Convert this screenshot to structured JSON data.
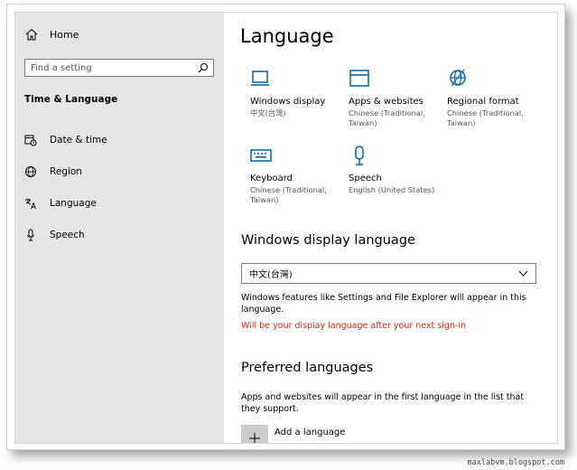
{
  "sidebar": {
    "home_label": "Home",
    "search_placeholder": "Find a setting",
    "section_title": "Time & Language",
    "items": [
      {
        "label": "Date & time",
        "icon": "calendar-clock-icon"
      },
      {
        "label": "Region",
        "icon": "globe-icon"
      },
      {
        "label": "Language",
        "icon": "language-icon"
      },
      {
        "label": "Speech",
        "icon": "microphone-icon"
      }
    ]
  },
  "main": {
    "title": "Language",
    "tiles": [
      {
        "name": "Windows display",
        "sub": "中文(台灣)",
        "icon": "monitor-icon"
      },
      {
        "name": "Apps & websites",
        "sub": "Chinese (Traditional, Taiwan)",
        "icon": "window-icon"
      },
      {
        "name": "Regional format",
        "sub": "Chinese (Traditional, Taiwan)",
        "icon": "globe-icon"
      },
      {
        "name": "Keyboard",
        "sub": "Chinese (Traditional, Taiwan)",
        "icon": "keyboard-icon"
      },
      {
        "name": "Speech",
        "sub": "English (United States)",
        "icon": "microphone-icon"
      }
    ],
    "display_language": {
      "heading": "Windows display language",
      "selected": "中文(台灣)",
      "description": "Windows features like Settings and File Explorer will appear in this language.",
      "notice": "Will be your display language after your next sign-in"
    },
    "preferred": {
      "heading": "Preferred languages",
      "description": "Apps and websites will appear in the first language in the list that they support.",
      "add_label": "Add a language"
    }
  },
  "watermark": "maxlabvm.blogspot.com",
  "colors": {
    "accent": "#0063b1",
    "notice": "#c42b1c",
    "sidebar_bg": "#e6e6e6"
  }
}
